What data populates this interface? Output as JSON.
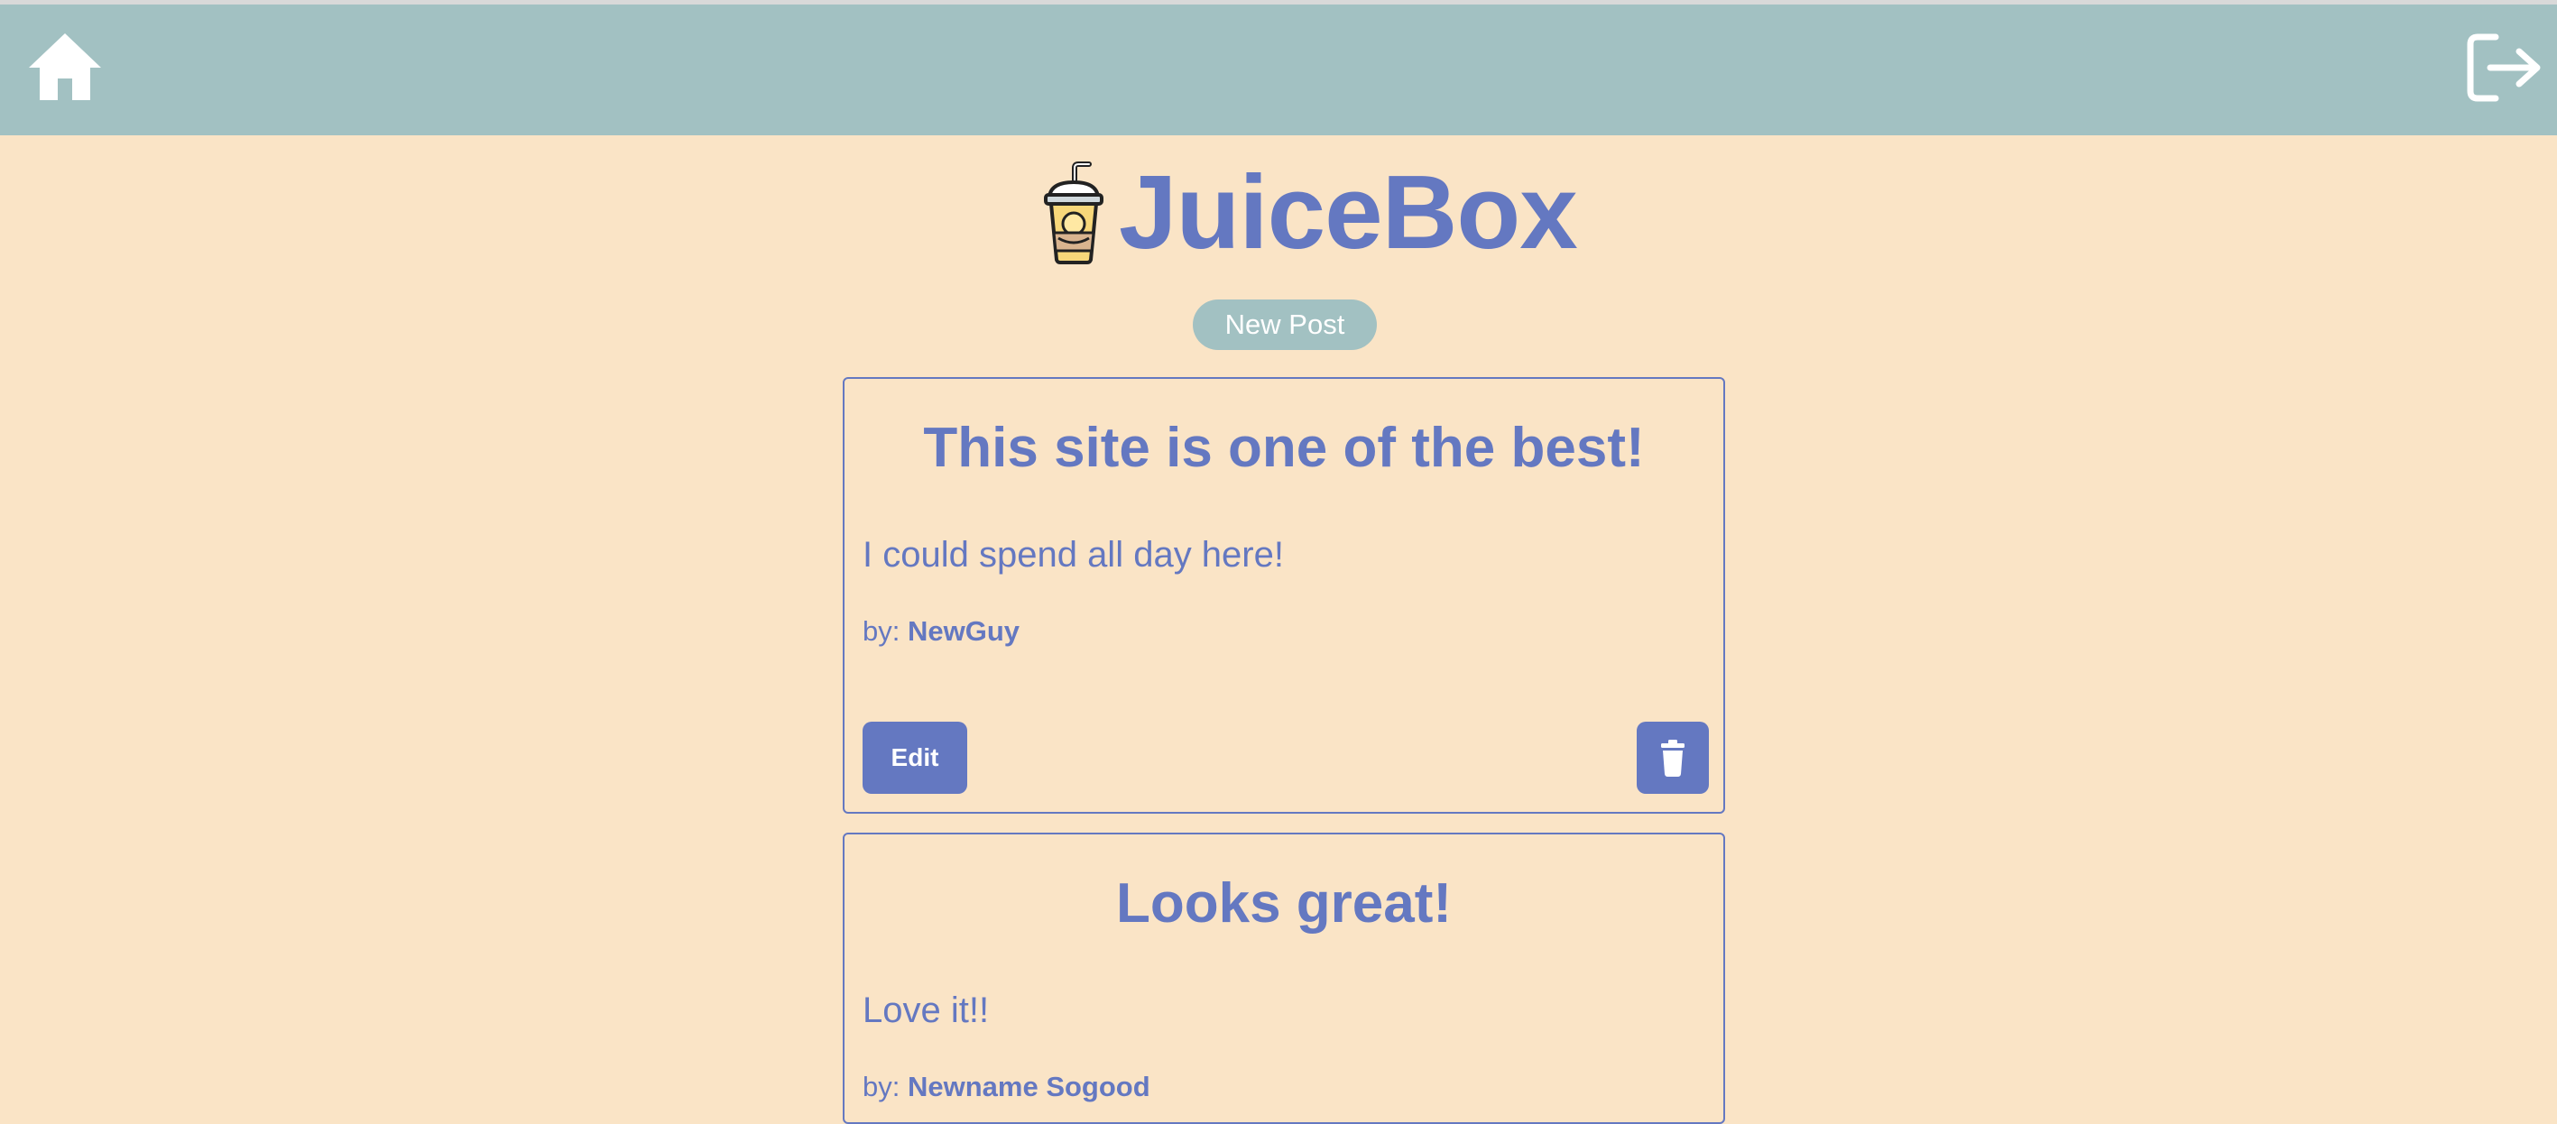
{
  "nav": {
    "home_icon": "home-icon",
    "logout_icon": "logout-icon"
  },
  "header": {
    "logo_icon": "juice-cup-icon",
    "title": "JuiceBox",
    "new_post_label": "New Post"
  },
  "posts": [
    {
      "title": "This site is one of the best!",
      "content": "I could spend all day here!",
      "by_label": "by:",
      "author": "NewGuy",
      "edit_label": "Edit",
      "delete_icon": "trash-icon"
    },
    {
      "title": "Looks great!",
      "content": "Love it!!",
      "by_label": "by:",
      "author": "Newname Sogood"
    }
  ],
  "colors": {
    "background": "#fae4c6",
    "navbar": "#a2c1c2",
    "accent": "#6478c1"
  }
}
